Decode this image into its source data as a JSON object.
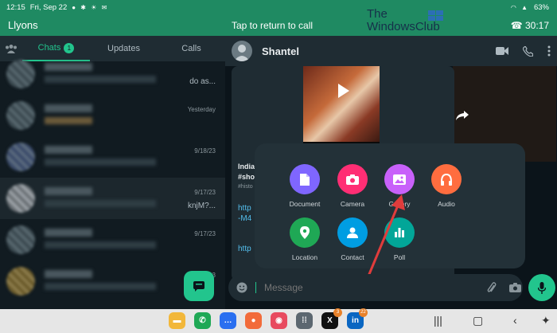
{
  "status": {
    "time": "12:15",
    "date": "Fri, Sep 22",
    "battery": "63%"
  },
  "left": {
    "title": "Llyons",
    "tabs": [
      {
        "label": "Chats",
        "badge": "1"
      },
      {
        "label": "Updates"
      },
      {
        "label": "Calls"
      }
    ],
    "chats": [
      {
        "time": "",
        "snippet": "do as..."
      },
      {
        "time": "Yesterday",
        "snippet": ""
      },
      {
        "time": "9/18/23",
        "snippet": ""
      },
      {
        "time": "9/17/23",
        "snippet": "knjM?..."
      },
      {
        "time": "9/17/23",
        "snippet": ""
      },
      {
        "time": "9/17/23",
        "snippet": ""
      }
    ]
  },
  "call": {
    "label": "Tap to return to call",
    "duration": "30:17"
  },
  "chat": {
    "contact": "Shantel",
    "link_title_1": "India",
    "link_title_2": "#sho",
    "link_tag": "#histo",
    "link_url_line1": "http",
    "link_url_line2": "-M4",
    "link_url_2": "http"
  },
  "attach": {
    "items": [
      {
        "label": "Document",
        "color": "#7f66ff",
        "icon": "document-icon"
      },
      {
        "label": "Camera",
        "color": "#ff2e74",
        "icon": "camera-icon"
      },
      {
        "label": "Gallery",
        "color": "#c861fa",
        "icon": "gallery-icon"
      },
      {
        "label": "Audio",
        "color": "#ff6d3f",
        "icon": "headphones-icon"
      },
      {
        "label": "Location",
        "color": "#1fa855",
        "icon": "location-pin-icon"
      },
      {
        "label": "Contact",
        "color": "#009de2",
        "icon": "person-icon"
      },
      {
        "label": "Poll",
        "color": "#02a698",
        "icon": "poll-icon"
      }
    ]
  },
  "input": {
    "placeholder": "Message"
  },
  "watermark": {
    "line1": "The",
    "line2": "WindowsClub"
  },
  "dock": {
    "x_badge": "3",
    "linkedin_badge": "22"
  },
  "colors": {
    "accent": "#22c58d",
    "header": "#1f8a62",
    "arrow": "#e03c3c"
  }
}
